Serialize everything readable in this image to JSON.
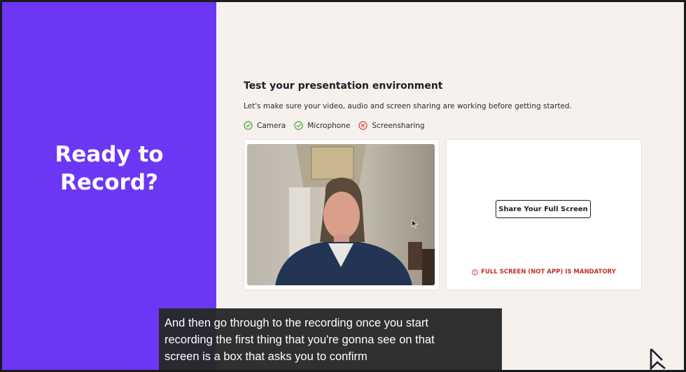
{
  "hero": {
    "line1": "Ready to",
    "line2": "Record?"
  },
  "main": {
    "heading": "Test your presentation environment",
    "subtext": "Let's make sure your video, audio and screen sharing are working before getting started."
  },
  "checks": [
    {
      "label": "Camera",
      "status": "ok",
      "icon": "check-circle-icon"
    },
    {
      "label": "Microphone",
      "status": "ok",
      "icon": "check-circle-icon"
    },
    {
      "label": "Screensharing",
      "status": "error",
      "icon": "x-circle-icon"
    }
  ],
  "share": {
    "button_label": "Share Your Full Screen",
    "warning": "FULL SCREEN (NOT APP) IS MANDATORY"
  },
  "caption": {
    "line1": "And then go through to the recording once you start",
    "line2": "recording the first thing that you're gonna see on that",
    "line3": "screen is a box that asks you to confirm"
  },
  "colors": {
    "brand_purple": "#6c37f4",
    "ok_green": "#4caf50",
    "error_red": "#d9534f",
    "warning_red": "#c0302a",
    "background": "#f6f1ec"
  }
}
